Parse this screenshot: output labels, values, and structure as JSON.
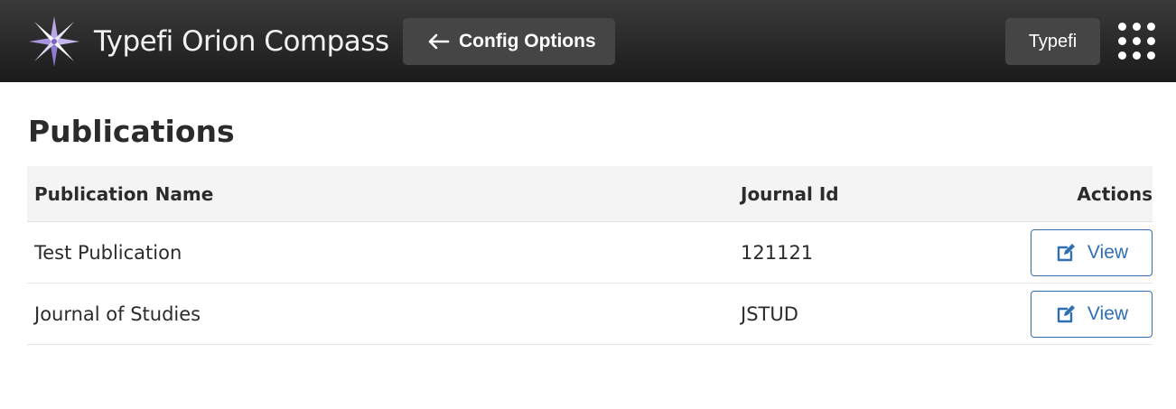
{
  "header": {
    "app_title": "Typefi Orion Compass",
    "config_button_label": "Config Options",
    "user_button_label": "Typefi",
    "icons": [
      "compass-logo-icon",
      "arrow-left-icon",
      "apps-grid-icon"
    ]
  },
  "main": {
    "title": "Publications",
    "table": {
      "columns": [
        "Publication Name",
        "Journal Id",
        "Actions"
      ],
      "rows": [
        {
          "name": "Test Publication",
          "journal_id": "121121",
          "action_label": "View"
        },
        {
          "name": "Journal of Studies",
          "journal_id": "JSTUD",
          "action_label": "View"
        }
      ]
    }
  },
  "colors": {
    "header_bg": "#232323",
    "header_button_bg": "#454545",
    "accent": "#2f6fb3",
    "table_header_bg": "#f4f4f4"
  }
}
